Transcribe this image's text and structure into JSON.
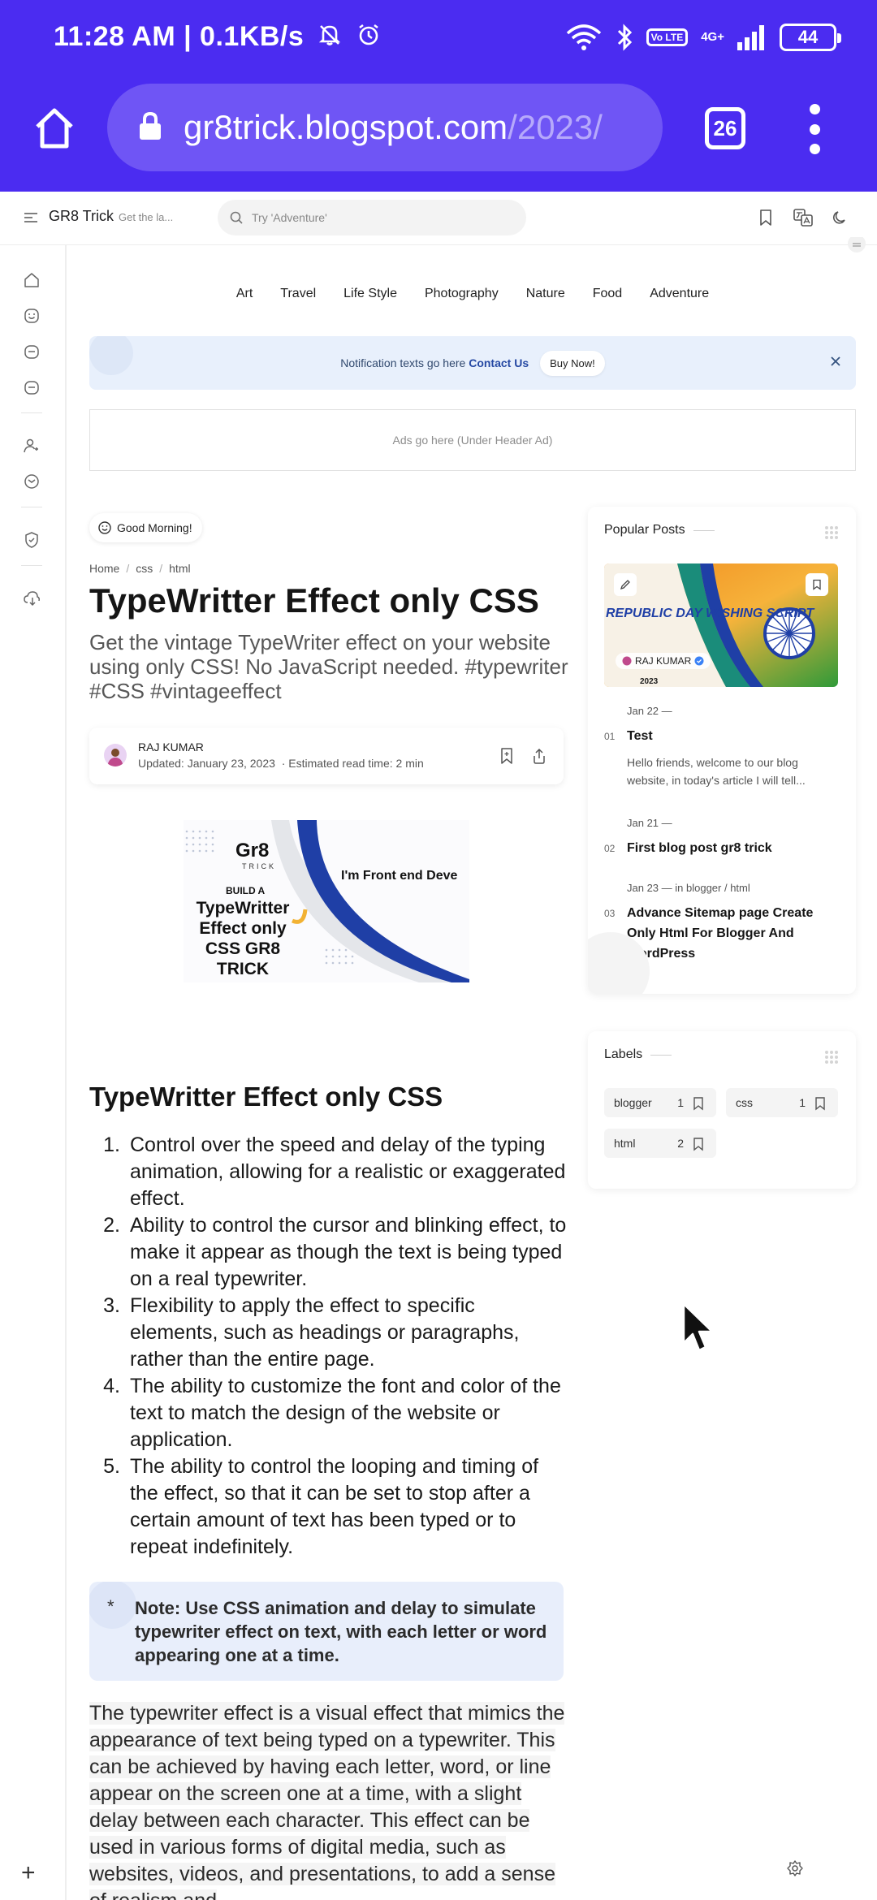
{
  "status": {
    "time": "11:28 AM | 0.1KB/s",
    "network": "4G+",
    "volte": "Vo LTE",
    "battery": "44"
  },
  "browser": {
    "url_host": "gr8trick.blogspot.com",
    "url_path": "/2023/",
    "tab_count": "26"
  },
  "header": {
    "site_title": "GR8 Trick",
    "tagline": "Get the la...",
    "search_placeholder": "Try 'Adventure'"
  },
  "nav": {
    "items": [
      "Art",
      "Travel",
      "Life Style",
      "Photography",
      "Nature",
      "Food",
      "Adventure"
    ]
  },
  "notification": {
    "text": "Notification texts go here",
    "link": "Contact Us",
    "button": "Buy Now!"
  },
  "ad": {
    "text": "Ads go here (Under Header Ad)"
  },
  "greeting": "Good Morning!",
  "breadcrumb": [
    "Home",
    "css",
    "html"
  ],
  "post": {
    "title": "TypeWritter Effect only CSS",
    "description": "Get the vintage TypeWriter effect on your website using only CSS! No JavaScript needed. #typewriter #CSS #vintageeffect",
    "author": "RAJ KUMAR",
    "updated": "Updated: January 23, 2023",
    "read_time": "· Estimated read time: 2 min",
    "thumbnail": {
      "brand": "Gr8",
      "brand_sub": "TRICK",
      "build": "BUILD A",
      "headline": "TypeWritter Effect only CSS GR8 TRICK",
      "typing": "I'm Front end Deve"
    },
    "section_title": "TypeWritter Effect only CSS",
    "list": [
      "Control over the speed and delay of the typing animation, allowing for a realistic or exaggerated effect.",
      "Ability to control the cursor and blinking effect, to make it appear as though the text is being typed on a real typewriter.",
      "Flexibility to apply the effect to specific elements, such as headings or paragraphs, rather than the entire page.",
      "The ability to customize the font and color of the text to match the design of the website or application.",
      "The ability to control the looping and timing of the effect, so that it can be set to stop after a certain amount of text has been typed or to repeat indefinitely."
    ],
    "note_star": "*",
    "note": "Note: Use CSS animation and delay to simulate typewriter effect on text, with each letter or word appearing one at a time.",
    "body": "The typewriter effect is a visual effect that mimics the appearance of text being typed on a typewriter. This can be achieved by having each letter, word, or line appear on the screen one at a time, with a slight delay between each character. This effect can be used in various forms of digital media, such as websites, videos, and presentations, to add a sense of realism and"
  },
  "popular": {
    "title": "Popular Posts",
    "featured": {
      "image_text": "REPUBLIC DAY WISHING SCRIPT",
      "year": "2023",
      "author": "RAJ KUMAR"
    },
    "items": [
      {
        "num": "01",
        "date": "Jan 22 —",
        "title": "Test",
        "snippet": "Hello friends, welcome to our blog website, in today's article I will tell..."
      },
      {
        "num": "02",
        "date": "Jan 21 —",
        "title": "First blog post gr8 trick"
      },
      {
        "num": "03",
        "date": "Jan 23 —   in blogger / html",
        "title": "Advance Sitemap page Create Only Html For Blogger And WordPress"
      }
    ]
  },
  "labels": {
    "title": "Labels",
    "items": [
      {
        "name": "blogger",
        "count": "1"
      },
      {
        "name": "css",
        "count": "1"
      },
      {
        "name": "html",
        "count": "2"
      }
    ]
  },
  "colors": {
    "browser_chrome": "#4b2cf1",
    "url_pill": "#6f55f5",
    "note_bg": "#e8eefb",
    "notif_bg": "#e8f0fc"
  },
  "icons": [
    "home-icon",
    "lock-icon",
    "more-vert-icon",
    "search-icon",
    "bookmark-icon",
    "translate-icon",
    "dark-mode-icon",
    "share-icon",
    "cursor-icon",
    "settings-icon"
  ]
}
